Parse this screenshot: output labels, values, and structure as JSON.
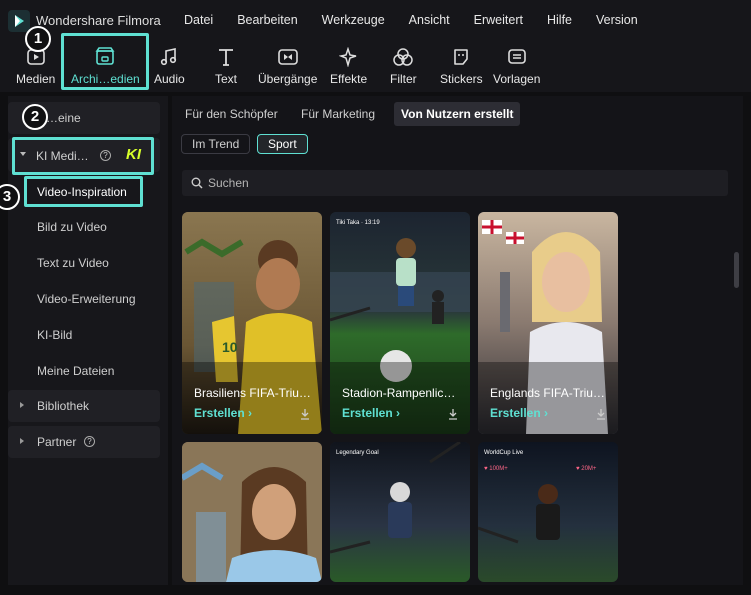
{
  "app": {
    "title": "Wondershare Filmora"
  },
  "menu": [
    "Datei",
    "Bearbeiten",
    "Werkzeuge",
    "Ansicht",
    "Erweitert",
    "Hilfe",
    "Version"
  ],
  "toolbar": [
    {
      "label": "Medien",
      "icon": "media-icon"
    },
    {
      "label": "Archi…edien",
      "icon": "store-icon",
      "active": true
    },
    {
      "label": "Audio",
      "icon": "music-note-icon"
    },
    {
      "label": "Text",
      "icon": "text-icon"
    },
    {
      "label": "Übergänge",
      "icon": "transition-icon"
    },
    {
      "label": "Effekte",
      "icon": "sparkle-icon"
    },
    {
      "label": "Filter",
      "icon": "filter-icon"
    },
    {
      "label": "Stickers",
      "icon": "sticker-icon"
    },
    {
      "label": "Vorlagen",
      "icon": "template-icon"
    }
  ],
  "sidebar": {
    "items": [
      {
        "label": "…eine"
      },
      {
        "label": "KI Medi…",
        "badge": "KI",
        "expanded": true
      },
      {
        "label": "Video-Inspiration",
        "selected": true
      },
      {
        "label": "Bild zu Video"
      },
      {
        "label": "Text zu Video"
      },
      {
        "label": "Video-Erweiterung"
      },
      {
        "label": "KI-Bild"
      },
      {
        "label": "Meine Dateien"
      },
      {
        "label": "Bibliothek"
      },
      {
        "label": "Partner"
      }
    ]
  },
  "tabs": [
    "Für den Schöpfer",
    "Für Marketing",
    "Von Nutzern erstellt"
  ],
  "active_tab": "Von Nutzern erstellt",
  "chips": [
    "Im Trend",
    "Sport"
  ],
  "active_chip": "Sport",
  "search": {
    "placeholder": "Suchen"
  },
  "cards": [
    {
      "title": "Brasiliens FIFA-Triu…",
      "action": "Erstellen"
    },
    {
      "title": "Stadion-Rampenlic…",
      "action": "Erstellen"
    },
    {
      "title": "Englands FIFA-Triu…",
      "action": "Erstellen"
    },
    {
      "title": "",
      "action": ""
    },
    {
      "title": "",
      "action": ""
    },
    {
      "title": "",
      "action": ""
    }
  ],
  "card_overlays": {
    "card2_top": "Tiki Taka · 13:19",
    "card5_top": "Legendary Goal",
    "card6_top": "WorldCup Live",
    "card6_count1": "100M+",
    "card6_count2": "20M+"
  },
  "annotations": [
    "1",
    "2",
    "3"
  ],
  "colors": {
    "accent": "#5fe0d2",
    "ki_badge": "#d7ff2a",
    "background": "#0f0f11"
  }
}
